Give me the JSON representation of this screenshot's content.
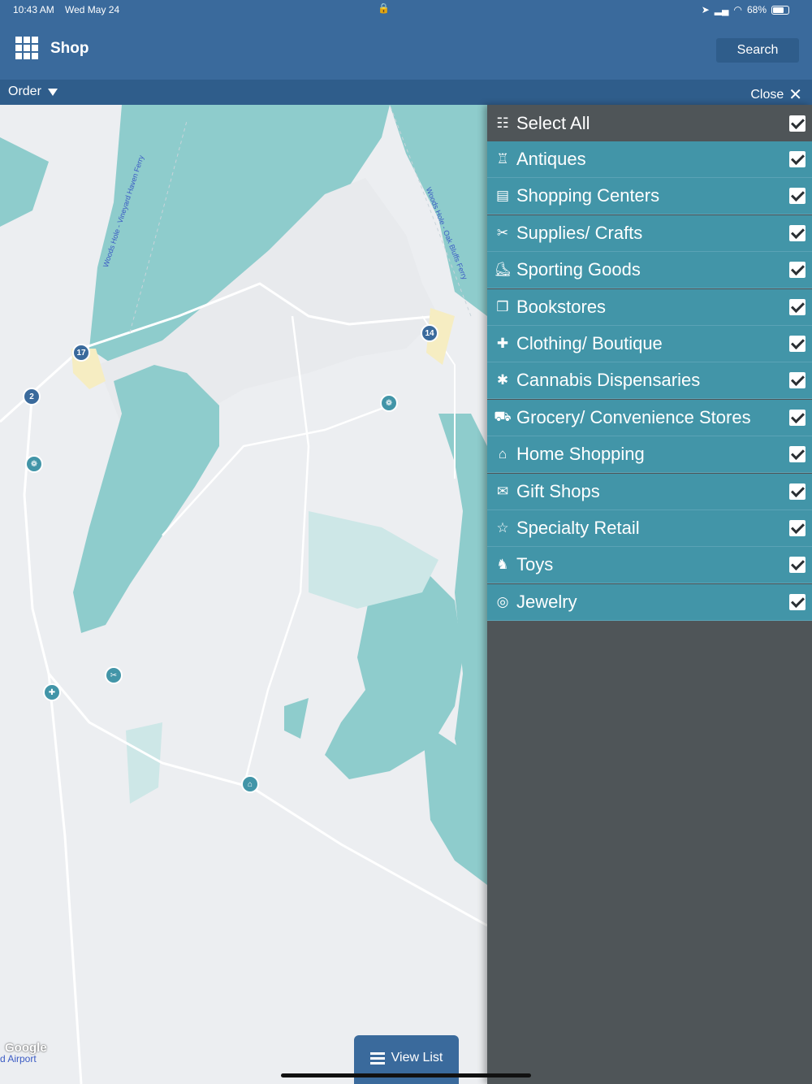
{
  "status": {
    "time": "10:43 AM",
    "date": "Wed May 24",
    "battery": "68%"
  },
  "header": {
    "title": "Shop",
    "search_label": "Search"
  },
  "subbar": {
    "order_label": "Order",
    "close_label": "Close"
  },
  "map": {
    "attribution": "Google",
    "airport_label": "d Airport",
    "ferry_labels": [
      "Woods Hole - Vineyard Haven Ferry",
      "Woods Hole - Oak Bluffs Ferry"
    ],
    "cluster_counts": [
      "17",
      "2",
      "14"
    ],
    "view_list_label": "View List"
  },
  "filters": {
    "select_all": {
      "label": "Select All",
      "icon": "list-icon",
      "checked": true
    },
    "items": [
      {
        "label": "Antiques",
        "icon": "lamp-icon",
        "glyph": "♖",
        "checked": true
      },
      {
        "label": "Shopping Centers",
        "icon": "store-icon",
        "glyph": "▤",
        "checked": true
      },
      {
        "label": "Supplies/ Crafts",
        "icon": "scissors-icon",
        "glyph": "✂",
        "checked": true
      },
      {
        "label": "Sporting Goods",
        "icon": "sneaker-icon",
        "glyph": "⛸",
        "checked": true
      },
      {
        "label": "Bookstores",
        "icon": "book-icon",
        "glyph": "❒",
        "checked": true
      },
      {
        "label": "Clothing/ Boutique",
        "icon": "shirt-icon",
        "glyph": "✚",
        "checked": true
      },
      {
        "label": "Cannabis Dispensaries",
        "icon": "leaf-icon",
        "glyph": "✱",
        "checked": true
      },
      {
        "label": "Grocery/ Convenience Stores",
        "icon": "cart-icon",
        "glyph": "⛟",
        "checked": true
      },
      {
        "label": "Home Shopping",
        "icon": "sofa-icon",
        "glyph": "⌂",
        "checked": true
      },
      {
        "label": "Gift Shops",
        "icon": "gift-icon",
        "glyph": "✉",
        "checked": true
      },
      {
        "label": "Specialty Retail",
        "icon": "star-icon",
        "glyph": "☆",
        "checked": true
      },
      {
        "label": "Toys",
        "icon": "rocking-horse-icon",
        "glyph": "♞",
        "checked": true
      },
      {
        "label": "Jewelry",
        "icon": "ring-icon",
        "glyph": "◎",
        "checked": true
      }
    ]
  },
  "colors": {
    "header": "#3a6a9c",
    "subbar": "#2f5d8b",
    "panel": "#4f5558",
    "category_row": "#4295a8",
    "water": "#8ecccc"
  }
}
